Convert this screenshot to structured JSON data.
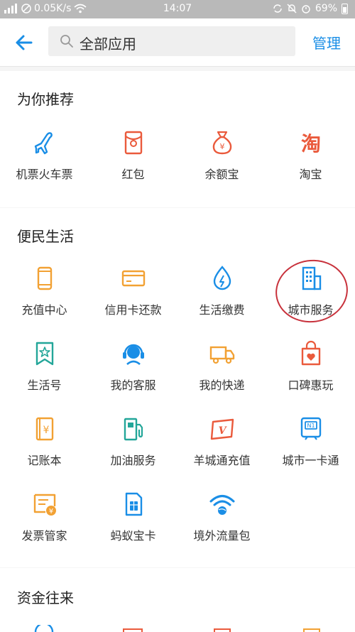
{
  "status_bar": {
    "network": "0.05K/s",
    "time": "14:07",
    "battery": "69%"
  },
  "header": {
    "search_text": "全部应用",
    "manage_label": "管理"
  },
  "sections": [
    {
      "title": "为你推荐",
      "items": [
        {
          "label": "机票火车票",
          "icon": "airplane-icon"
        },
        {
          "label": "红包",
          "icon": "red-envelope-icon"
        },
        {
          "label": "余额宝",
          "icon": "money-bag-icon"
        },
        {
          "label": "淘宝",
          "icon": "taobao-icon"
        }
      ]
    },
    {
      "title": "便民生活",
      "items": [
        {
          "label": "充值中心",
          "icon": "phone-icon"
        },
        {
          "label": "信用卡还款",
          "icon": "credit-card-icon"
        },
        {
          "label": "生活缴费",
          "icon": "utility-drop-icon"
        },
        {
          "label": "城市服务",
          "icon": "building-icon"
        },
        {
          "label": "生活号",
          "icon": "star-badge-icon"
        },
        {
          "label": "我的客服",
          "icon": "headset-icon"
        },
        {
          "label": "我的快递",
          "icon": "truck-icon"
        },
        {
          "label": "口碑惠玩",
          "icon": "shopping-bag-icon"
        },
        {
          "label": "记账本",
          "icon": "ledger-icon"
        },
        {
          "label": "加油服务",
          "icon": "fuel-pump-icon"
        },
        {
          "label": "羊城通充值",
          "icon": "card-v-icon"
        },
        {
          "label": "城市一卡通",
          "icon": "city-card-icon"
        },
        {
          "label": "发票管家",
          "icon": "invoice-icon"
        },
        {
          "label": "蚂蚁宝卡",
          "icon": "sim-card-icon"
        },
        {
          "label": "境外流量包",
          "icon": "wifi-globe-icon"
        }
      ]
    },
    {
      "title": "资金往来",
      "items": []
    }
  ],
  "colors": {
    "accent_blue": "#1a8ee6",
    "orange": "#f2a133",
    "red": "#ea5a3c",
    "teal": "#23a699",
    "circle_red": "#c8323c"
  }
}
